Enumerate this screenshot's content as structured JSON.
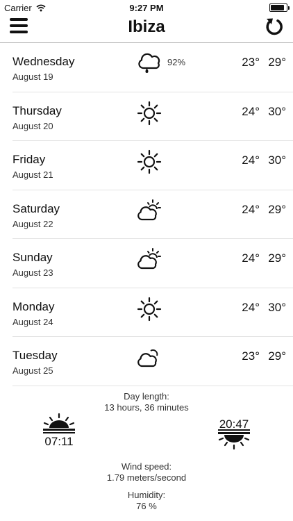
{
  "status": {
    "carrier": "Carrier",
    "time": "9:27 PM",
    "battery_level": 0.85
  },
  "nav": {
    "title": "Ibiza",
    "menu_icon": "hamburger-icon",
    "refresh_icon": "refresh-icon"
  },
  "forecast": [
    {
      "day": "Wednesday",
      "date": "August 19",
      "icon": "rain-cloud-icon",
      "precip": "92%",
      "low": "23°",
      "high": "29°"
    },
    {
      "day": "Thursday",
      "date": "August 20",
      "icon": "sun-icon",
      "precip": "",
      "low": "24°",
      "high": "30°"
    },
    {
      "day": "Friday",
      "date": "August 21",
      "icon": "sun-icon",
      "precip": "",
      "low": "24°",
      "high": "30°"
    },
    {
      "day": "Saturday",
      "date": "August 22",
      "icon": "partly-cloudy-icon",
      "precip": "",
      "low": "24°",
      "high": "29°"
    },
    {
      "day": "Sunday",
      "date": "August 23",
      "icon": "partly-cloudy-icon",
      "precip": "",
      "low": "24°",
      "high": "29°"
    },
    {
      "day": "Monday",
      "date": "August 24",
      "icon": "sun-icon",
      "precip": "",
      "low": "24°",
      "high": "30°"
    },
    {
      "day": "Tuesday",
      "date": "August 25",
      "icon": "cloud-sun-icon",
      "precip": "",
      "low": "23°",
      "high": "29°"
    }
  ],
  "info": {
    "day_length_label": "Day length:",
    "day_length_value": "13 hours, 36 minutes",
    "sunrise_time": "07:11",
    "sunset_time": "20:47",
    "wind_label": "Wind speed:",
    "wind_value": "1.79 meters/second",
    "humidity_label": "Humidity:",
    "humidity_value": "76 %"
  }
}
